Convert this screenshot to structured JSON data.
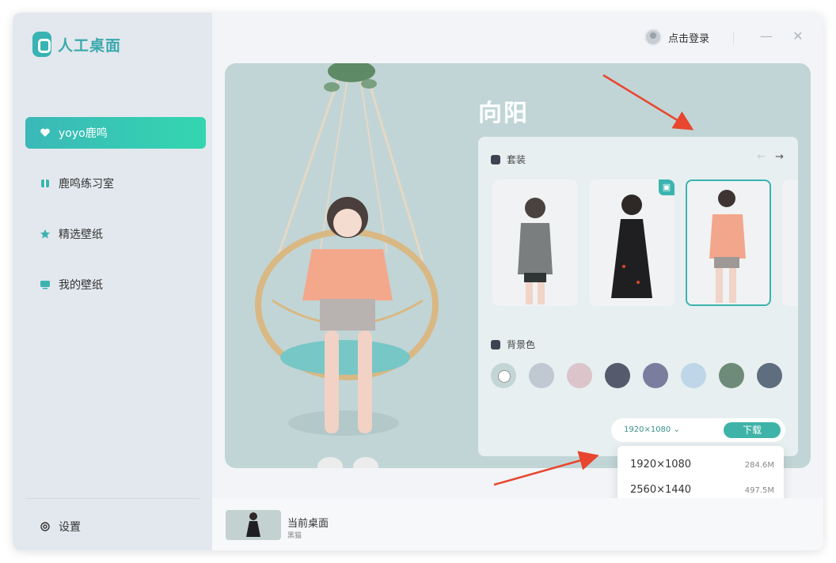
{
  "app": {
    "logo_text": "人工桌面"
  },
  "header": {
    "login_label": "点击登录",
    "minimize_symbol": "—",
    "close_symbol": "✕"
  },
  "sidebar": {
    "items": [
      {
        "label": "yoyo鹿鸣",
        "icon": "heart-icon",
        "active": true
      },
      {
        "label": "鹿鸣练习室",
        "icon": "book-icon",
        "active": false
      },
      {
        "label": "精选壁纸",
        "icon": "star-icon",
        "active": false
      },
      {
        "label": "我的壁纸",
        "icon": "monitor-icon",
        "active": false
      }
    ],
    "settings_label": "设置"
  },
  "main": {
    "character_name": "向阳",
    "outfit_section": {
      "label": "套装",
      "prev_symbol": "←",
      "next_symbol": "→"
    },
    "outfits": [
      {
        "name": "grey-cardigan-outfit",
        "selected": false,
        "badge": false
      },
      {
        "name": "black-dress-outfit",
        "selected": false,
        "badge": true
      },
      {
        "name": "peach-tshirt-outfit",
        "selected": true,
        "badge": false
      }
    ],
    "background_section": {
      "label": "背景色"
    },
    "swatches": [
      "#c3d5d4",
      "#c0c8d2",
      "#dcc4cb",
      "#555b6c",
      "#7a7e9e",
      "#bed6e8",
      "#6e8a78",
      "#5e6e7f"
    ],
    "download": {
      "resolution": "1920×1080",
      "button_label": "下载"
    }
  },
  "dropdown": {
    "options": [
      {
        "resolution": "1920×1080",
        "size": "284.6M"
      },
      {
        "resolution": "2560×1440",
        "size": "497.5M"
      }
    ]
  },
  "current": {
    "title": "当前桌面",
    "subtitle": "黑猫"
  },
  "colors": {
    "accent": "#3bb4b0",
    "annotation_arrow": "#e8462f"
  }
}
